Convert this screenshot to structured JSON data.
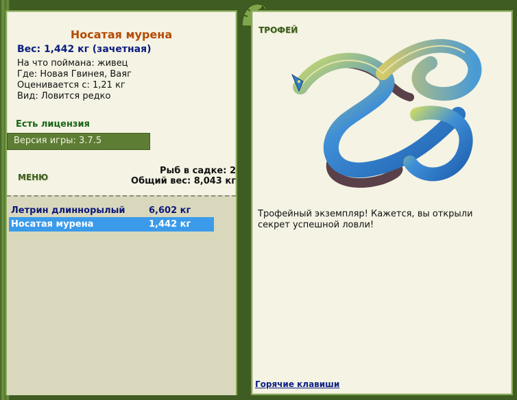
{
  "fish": {
    "name": "Носатая мурена",
    "weight_line": "Вес: 1,442 кг (зачетная)",
    "caught_on": "На что поймана: живец",
    "where": "Где: Новая Гвинея, Ваяг",
    "valued_from": "Оцениваетcя с: 1,21 кг",
    "kind": "Вид: Ловится редко"
  },
  "license": "Есть лицензия",
  "version": "Версия игры: 3.7.5",
  "menu_label": "МЕНЮ",
  "stats": {
    "fish_in_keepnet": "Рыб в садке: 2",
    "total_weight": "Общий вес: 8,043 кг"
  },
  "catch_list": [
    {
      "name": "Летрин длиннорылый",
      "weight": "6,602 кг",
      "selected": false
    },
    {
      "name": "Носатая мурена",
      "weight": "1,442 кг",
      "selected": true
    }
  ],
  "trophy_label": "ТРОФЕЙ",
  "trophy_text": "Трофейный экземпляр! Кажется, вы открыли секрет успешной ловли!",
  "hotkeys_link": "Горячие клавиши",
  "colors": {
    "panel_bg": "#f4f3e4",
    "frame": "#4d6e2a",
    "title": "#b64a00",
    "accent_blue": "#0a1c7e",
    "selected_row": "#3b9bea"
  }
}
